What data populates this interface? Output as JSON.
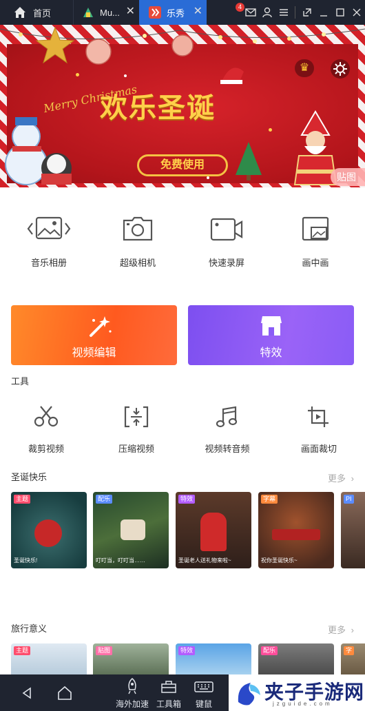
{
  "tabs": [
    {
      "label": "首页",
      "icon": "home-icon"
    },
    {
      "label": "Mu...",
      "icon": "mumu-icon"
    },
    {
      "label": "乐秀",
      "icon": "lexiu-app-icon",
      "active": true
    }
  ],
  "window": {
    "mail_count": "4"
  },
  "banner": {
    "title": "欢乐圣诞",
    "button": "免费使用",
    "merry_text": "Merry Christmas",
    "sticker_label": "贴图"
  },
  "features": [
    {
      "label": "音乐相册",
      "icon": "photo-album-icon"
    },
    {
      "label": "超级相机",
      "icon": "camera-icon"
    },
    {
      "label": "快速录屏",
      "icon": "screen-record-icon"
    },
    {
      "label": "画中画",
      "icon": "picture-in-picture-icon"
    }
  ],
  "big_buttons": [
    {
      "label": "视频编辑",
      "color": "#ff6a2b"
    },
    {
      "label": "特效",
      "color": "#8a5cf6"
    }
  ],
  "tools_section": {
    "title": "工具"
  },
  "tools": [
    {
      "label": "裁剪视频",
      "icon": "scissors-icon"
    },
    {
      "label": "压缩视频",
      "icon": "compress-icon"
    },
    {
      "label": "视频转音频",
      "icon": "music-note-icon"
    },
    {
      "label": "画面裁切",
      "icon": "crop-icon"
    }
  ],
  "christmas_section": {
    "title": "圣诞快乐",
    "more": "更多",
    "cards": [
      {
        "badge": "主题",
        "caption": "圣诞快乐!",
        "badge_color": "#ff4d6d"
      },
      {
        "badge": "配乐",
        "caption": "叮叮当，叮叮当……",
        "badge_color": "#5b8cff"
      },
      {
        "badge": "特效",
        "caption": "圣诞老人送礼物来啦~",
        "badge_color": "#b35cff"
      },
      {
        "badge": "字幕",
        "caption": "祝你圣诞快乐~",
        "badge_color": "#ff8a3d"
      },
      {
        "badge": "PI",
        "caption": "",
        "badge_color": "#5b8cff"
      }
    ]
  },
  "travel_section": {
    "title": "旅行意义",
    "more": "更多",
    "cards": [
      {
        "badge": "主题",
        "badge_color": "#ff4d6d"
      },
      {
        "badge": "贴图",
        "badge_color": "#ff6fa8"
      },
      {
        "badge": "特效",
        "badge_color": "#b35cff"
      },
      {
        "badge": "配乐",
        "badge_color": "#ff4d9a"
      },
      {
        "badge": "字",
        "badge_color": "#ff8a3d"
      }
    ]
  },
  "nav": [
    {
      "label": "",
      "icon": "back-icon"
    },
    {
      "label": "",
      "icon": "home-icon"
    },
    {
      "label": "海外加速",
      "icon": "rocket-icon"
    },
    {
      "label": "工具箱",
      "icon": "toolbox-icon"
    },
    {
      "label": "键鼠",
      "icon": "keyboard-icon"
    }
  ],
  "watermark": {
    "title": "夹子手游网",
    "url": "jzguide.com"
  }
}
